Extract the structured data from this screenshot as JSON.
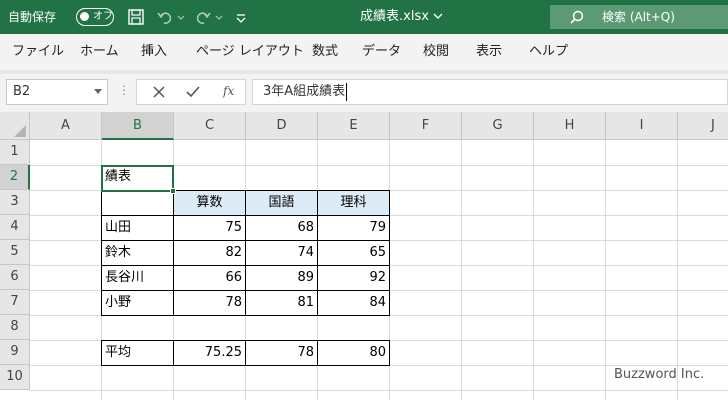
{
  "titlebar": {
    "autosave_label": "自動保存",
    "autosave_toggle": "オフ",
    "filename": "成績表.xlsx",
    "search_label": "検索 (Alt+Q)"
  },
  "menu": {
    "items": [
      "ファイル",
      "ホーム",
      "挿入",
      "ページ レイアウト",
      "数式",
      "データ",
      "校閲",
      "表示",
      "ヘルプ"
    ]
  },
  "formula_bar": {
    "name_box": "B2",
    "fx": "fx",
    "content": "3年A組成績表"
  },
  "grid": {
    "columns": [
      "A",
      "B",
      "C",
      "D",
      "E",
      "F",
      "G",
      "H",
      "I",
      "J"
    ],
    "rows": [
      "1",
      "2",
      "3",
      "4",
      "5",
      "6",
      "7",
      "8",
      "9",
      "10"
    ],
    "selected_column": "B",
    "selected_row": "2"
  },
  "sheet": {
    "b2": "績表",
    "headers": [
      "算数",
      "国語",
      "理科"
    ],
    "students": [
      {
        "name": "山田",
        "math": "75",
        "japanese": "68",
        "science": "79"
      },
      {
        "name": "鈴木",
        "math": "82",
        "japanese": "74",
        "science": "65"
      },
      {
        "name": "長谷川",
        "math": "66",
        "japanese": "89",
        "science": "92"
      },
      {
        "name": "小野",
        "math": "78",
        "japanese": "81",
        "science": "84"
      }
    ],
    "average": {
      "label": "平均",
      "math": "75.25",
      "japanese": "78",
      "science": "80"
    }
  },
  "watermark": "Buzzword Inc.",
  "colors": {
    "accent": "#217346",
    "header_fill": "#ddebf7"
  }
}
